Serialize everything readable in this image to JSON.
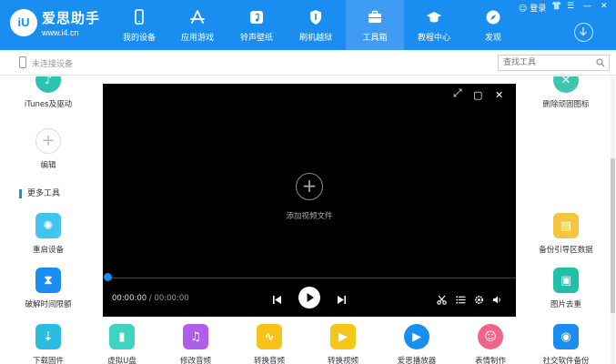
{
  "app": {
    "brand_name": "爱思助手",
    "brand_url": "www.i4.cn",
    "logo_text": "iU"
  },
  "window_controls": {
    "login": "登录",
    "pin_icon": "shirt-icon",
    "menu_icon": "menu-icon",
    "minimize_icon": "minimize-icon",
    "close_icon": "close-icon"
  },
  "nav": {
    "items": [
      {
        "label": "我的设备",
        "icon": "phone-icon",
        "active": false
      },
      {
        "label": "应用游戏",
        "icon": "app-store-icon",
        "active": false
      },
      {
        "label": "铃声壁纸",
        "icon": "music-note-icon",
        "active": false
      },
      {
        "label": "刷机越狱",
        "icon": "shield-icon",
        "active": false
      },
      {
        "label": "工具箱",
        "icon": "toolbox-icon",
        "active": true
      },
      {
        "label": "教程中心",
        "icon": "graduation-cap-icon",
        "active": false
      },
      {
        "label": "发现",
        "icon": "compass-icon",
        "active": false
      }
    ],
    "download_icon": "download-icon"
  },
  "subbar": {
    "device_status": "未连接设备",
    "search_placeholder": "查找工具"
  },
  "tools": {
    "top_row": [
      {
        "label": "iTunes及驱动",
        "icon": "itunes-icon",
        "color": "#2bc4b3"
      },
      {
        "label": "删除顽固图标",
        "icon": "delete-icon-icon",
        "color": "#3dc6ad"
      }
    ],
    "edit_label": "编辑",
    "section_title": "更多工具",
    "row2": [
      {
        "label": "重启设备",
        "icon": "restart-icon",
        "color": "#42c4f0"
      },
      {
        "label": "备份引导区数据",
        "icon": "backup-icon",
        "color": "#f5c542"
      }
    ],
    "row3": [
      {
        "label": "破解时间限额",
        "icon": "hourglass-icon",
        "color": "#1a8ef0"
      },
      {
        "label": "图片去重",
        "icon": "image-icon",
        "color": "#20c0a6"
      }
    ],
    "bottom_row": [
      {
        "label": "下载固件",
        "icon": "download-firmware-icon",
        "color": "#2bbde0"
      },
      {
        "label": "虚拟U盘",
        "icon": "usb-icon",
        "color": "#3fd4c0"
      },
      {
        "label": "修改音频",
        "icon": "audio-edit-icon",
        "color": "#b05de8"
      },
      {
        "label": "转换音频",
        "icon": "waveform-icon",
        "color": "#f7c21a"
      },
      {
        "label": "转换视频",
        "icon": "video-convert-icon",
        "color": "#f5c518"
      },
      {
        "label": "爱思播放器",
        "icon": "play-circle-icon",
        "color": "#1a8ef0"
      },
      {
        "label": "表情制作",
        "icon": "emoji-icon",
        "color": "#f0648a"
      },
      {
        "label": "社交软件备份",
        "icon": "social-backup-icon",
        "color": "#1a8ef0"
      }
    ]
  },
  "player": {
    "add_file_label": "添加视频文件",
    "current_time": "00:00:00",
    "separator": " / ",
    "duration": "00:00:00",
    "progress": 0,
    "controls": [
      "prev-icon",
      "play-icon",
      "next-icon",
      "scissors-icon",
      "playlist-icon",
      "settings-icon",
      "volume-icon"
    ],
    "window_buttons": [
      "fullscreen-icon",
      "maximize-icon",
      "close-icon"
    ]
  }
}
